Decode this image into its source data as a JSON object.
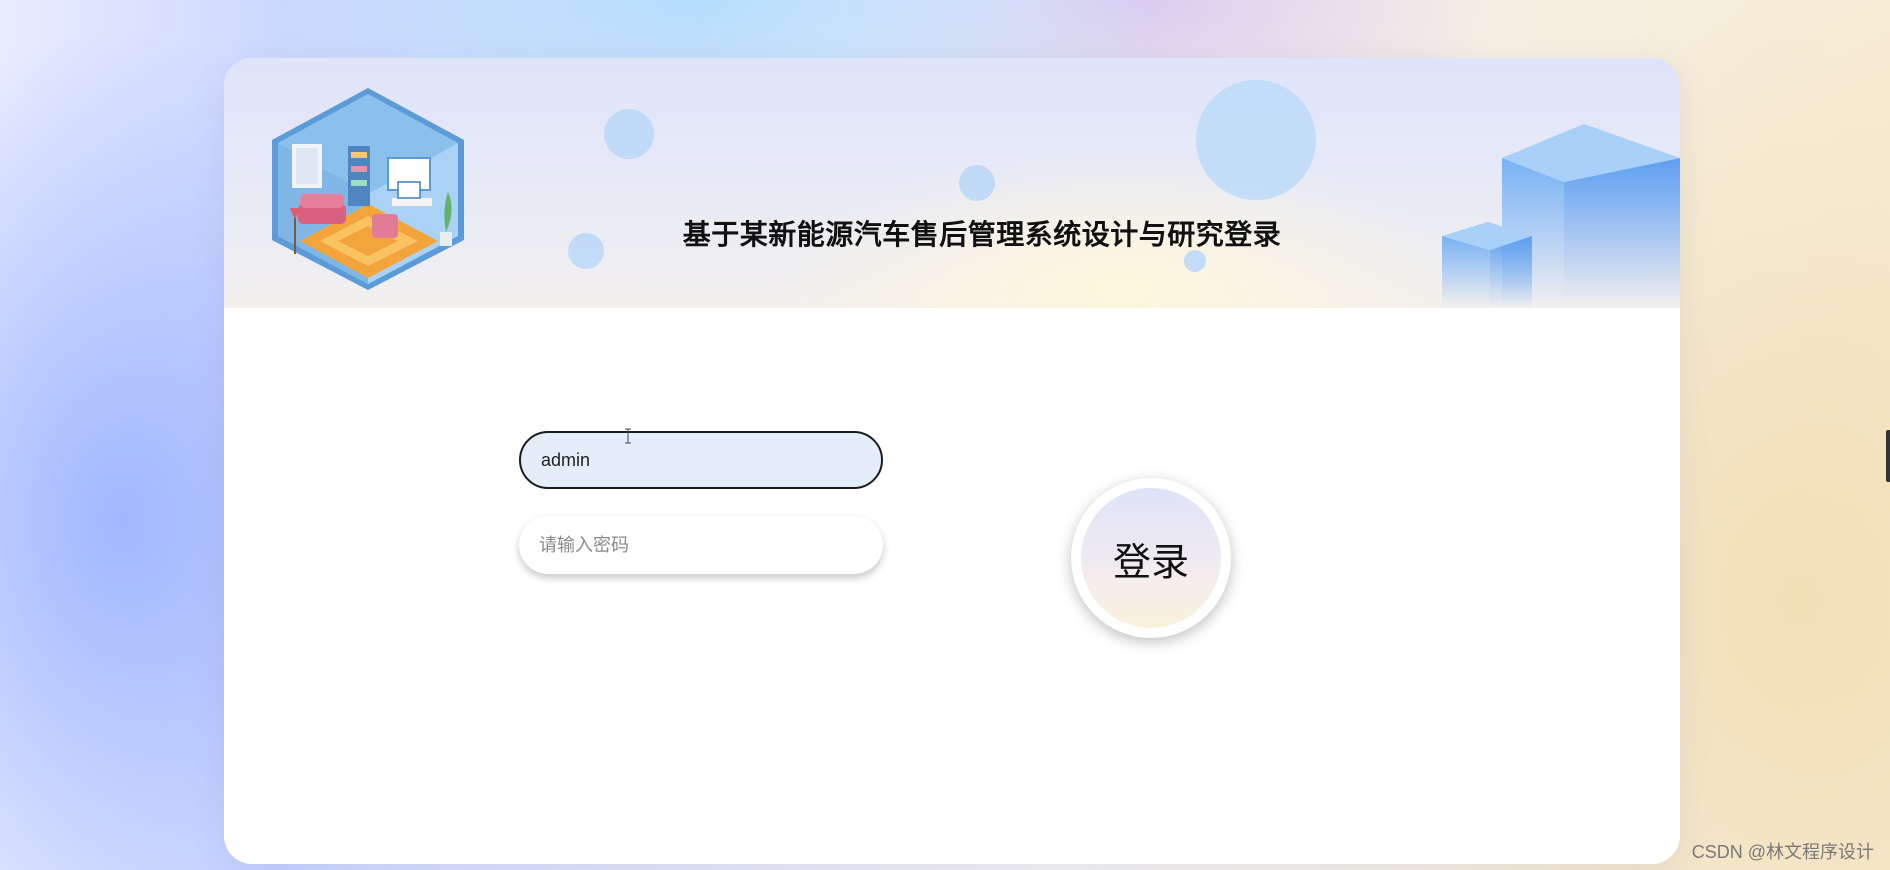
{
  "header": {
    "title": "基于某新能源汽车售后管理系统设计与研究登录",
    "illustration_icon": "room-illustration-icon",
    "decoration_icon": "cubes-decoration-icon"
  },
  "form": {
    "username_value": "admin",
    "password_placeholder": "请输入密码",
    "login_label": "登录"
  },
  "watermark": "CSDN @林文程序设计",
  "colors": {
    "input_active_bg": "#e4eefb",
    "bubble": "#bcd8f7",
    "cube_blue": "#6eaaf5"
  }
}
